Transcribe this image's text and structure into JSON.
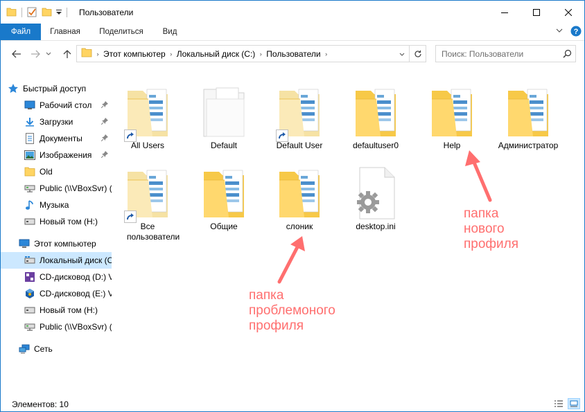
{
  "window": {
    "title": "Пользователи"
  },
  "ribbon": {
    "tabs": [
      "Файл",
      "Главная",
      "Поделиться",
      "Вид"
    ]
  },
  "address": {
    "breadcrumb": [
      "Этот компьютер",
      "Локальный диск (C:)",
      "Пользователи"
    ]
  },
  "search": {
    "placeholder": "Поиск: Пользователи"
  },
  "nav": {
    "quick_access": "Быстрый доступ",
    "quick_items": [
      "Рабочий стол",
      "Загрузки",
      "Документы",
      "Изображения",
      "Old",
      "Public (\\\\VBoxSvr) (",
      "Музыка",
      "Новый том (H:)"
    ],
    "this_pc": "Этот компьютер",
    "pc_items": [
      "Локальный диск (C",
      "CD-дисковод (D:) V",
      "CD-дисковод (E:) V",
      "Новый том (H:)",
      "Public (\\\\VBoxSvr) ("
    ],
    "network": "Сеть"
  },
  "files": [
    {
      "name": "All Users",
      "type": "folder-light",
      "shortcut": true
    },
    {
      "name": "Default",
      "type": "folder-white",
      "shortcut": false
    },
    {
      "name": "Default User",
      "type": "folder-light",
      "shortcut": true
    },
    {
      "name": "defaultuser0",
      "type": "folder-docs",
      "shortcut": false
    },
    {
      "name": "Help",
      "type": "folder-docs",
      "shortcut": false
    },
    {
      "name": "Администратор",
      "type": "folder-docs",
      "shortcut": false
    },
    {
      "name": "Все пользователи",
      "type": "folder-light",
      "shortcut": true
    },
    {
      "name": "Общие",
      "type": "folder-docs",
      "shortcut": false
    },
    {
      "name": "слоник",
      "type": "folder-docs",
      "shortcut": false
    },
    {
      "name": "desktop.ini",
      "type": "settings-file",
      "shortcut": false
    }
  ],
  "annotations": {
    "new_profile": [
      "папка",
      "нового",
      "профиля"
    ],
    "problem_profile": [
      "папка",
      "проблемоного",
      "профиля"
    ],
    "color": "#ff6f6f"
  },
  "status": {
    "items_count": "Элементов: 10"
  },
  "colors": {
    "accent": "#1979ca",
    "selection": "#cce8ff",
    "folder": "#ffd462"
  }
}
